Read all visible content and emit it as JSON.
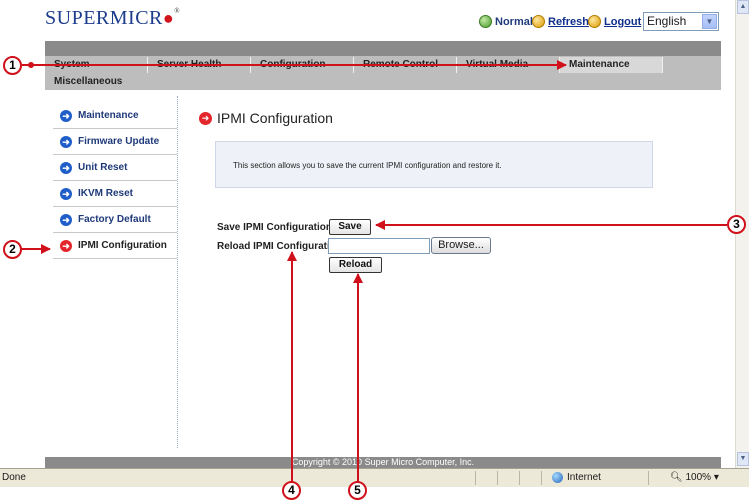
{
  "brand": {
    "name": "SUPERMICR",
    "mark": "®"
  },
  "header_status": {
    "normal": "Normal",
    "refresh": "Refresh",
    "logout": "Logout",
    "language": "English"
  },
  "nav": {
    "tabs": [
      "System",
      "Server Health",
      "Configuration",
      "Remote Control",
      "Virtual Media",
      "Maintenance"
    ],
    "active_tab": "Maintenance",
    "second_row": [
      "Miscellaneous"
    ]
  },
  "sidebar": {
    "items": [
      {
        "label": "Maintenance"
      },
      {
        "label": "Firmware Update"
      },
      {
        "label": "Unit Reset"
      },
      {
        "label": "IKVM Reset"
      },
      {
        "label": "Factory Default"
      },
      {
        "label": "IPMI Configuration",
        "active": true
      }
    ]
  },
  "main": {
    "title": "IPMI Configuration",
    "info": "This section allows you to save the current IPMI configuration and restore it.",
    "save_label": "Save IPMI Configuration",
    "save_button": "Save",
    "reload_label": "Reload IPMI Configuration",
    "file_value": "",
    "browse_button": "Browse...",
    "reload_button": "Reload"
  },
  "footer": {
    "copyright": "Copyright © 2010 Super Micro Computer, Inc."
  },
  "browser_status": {
    "status": "Done",
    "zone": "Internet",
    "zoom": "100%"
  },
  "callouts": [
    "1",
    "2",
    "3",
    "4",
    "5"
  ],
  "colors": {
    "accent_red": "#d0101a",
    "nav_gray": "#bdbdbd",
    "link_blue": "#0f2f8c"
  }
}
